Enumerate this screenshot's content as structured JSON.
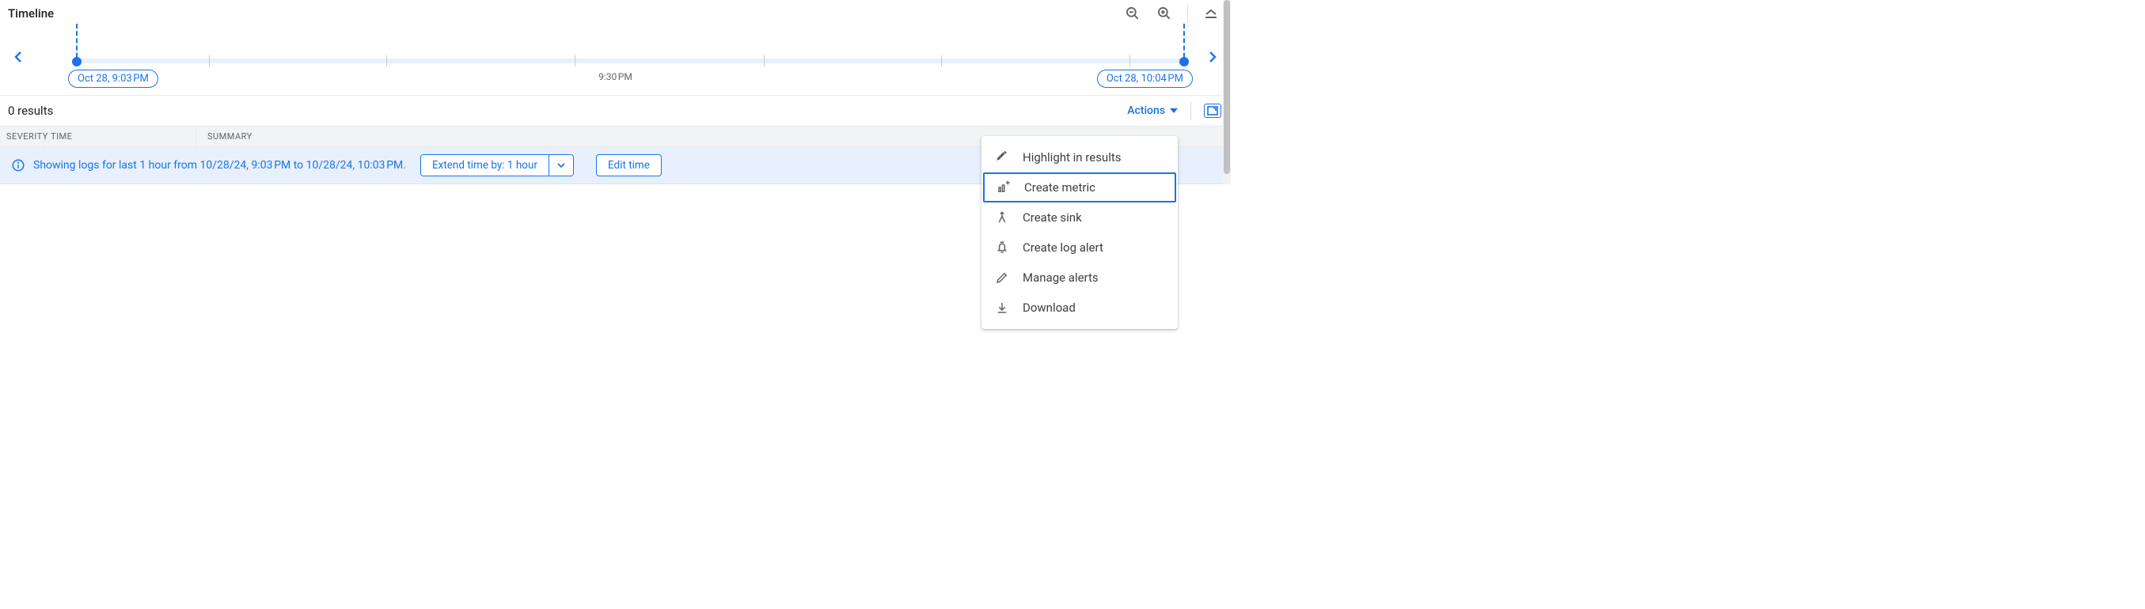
{
  "header": {
    "title": "Timeline"
  },
  "timeline": {
    "start_chip": "Oct 28, 9:03 PM",
    "end_chip": "Oct 28, 10:04 PM",
    "center_label": "9:30 PM"
  },
  "results": {
    "count_label": "0 results",
    "actions_label": "Actions"
  },
  "columns": {
    "severity": "Severity",
    "time": "Time",
    "summary": "Summary"
  },
  "info_row": {
    "text": "Showing logs for last 1 hour from 10/28/24, 9:03 PM to 10/28/24, 10:03 PM.",
    "extend_label": "Extend time by: 1 hour",
    "edit_label": "Edit time"
  },
  "actions_menu": {
    "items": [
      {
        "icon": "highlighter-icon",
        "label": "Highlight in results"
      },
      {
        "icon": "metric-icon",
        "label": "Create metric"
      },
      {
        "icon": "sink-icon",
        "label": "Create sink"
      },
      {
        "icon": "bell-icon",
        "label": "Create log alert"
      },
      {
        "icon": "pencil-icon",
        "label": "Manage alerts"
      },
      {
        "icon": "download-icon",
        "label": "Download"
      }
    ],
    "highlighted_index": 1
  }
}
